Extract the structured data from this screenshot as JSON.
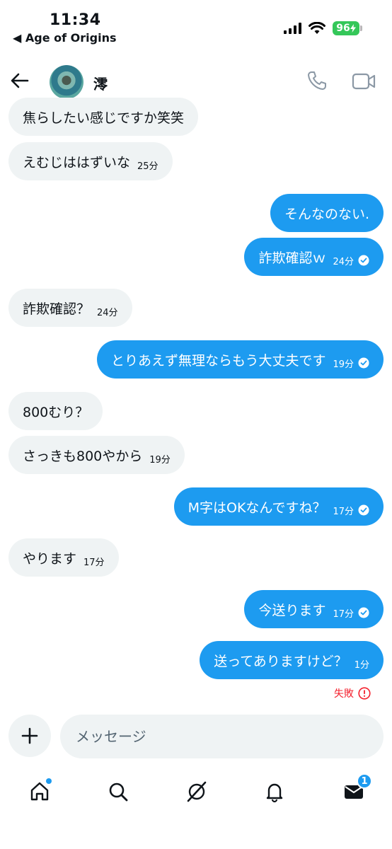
{
  "status": {
    "time": "11:34",
    "back_app": "◀ Age of Origins",
    "battery": "96"
  },
  "header": {
    "name": "澪"
  },
  "messages": [
    {
      "dir": "in",
      "text": "焦らしたい感じですか笑笑",
      "time": ""
    },
    {
      "dir": "in",
      "text": "えむじははずいな",
      "time": "25分"
    },
    {
      "dir": "out",
      "text": "そんなのない.",
      "time": ""
    },
    {
      "dir": "out",
      "text": "詐欺確認ｗ",
      "time": "24分"
    },
    {
      "dir": "in",
      "text": "詐欺確認？",
      "time": "24分"
    },
    {
      "dir": "out",
      "text": "とりあえず無理ならもう大丈夫です",
      "time": "19分"
    },
    {
      "dir": "in",
      "text": "800むり？",
      "time": ""
    },
    {
      "dir": "in",
      "text": "さっきも800やから",
      "time": "19分"
    },
    {
      "dir": "out",
      "text": "M字はOKなんですね？",
      "time": "17分"
    },
    {
      "dir": "in",
      "text": "やります",
      "time": "17分"
    },
    {
      "dir": "out",
      "text": "今送ります",
      "time": "17分"
    },
    {
      "dir": "out",
      "text": "送ってありますけど？",
      "time": "1分"
    }
  ],
  "failed_label": "失敗",
  "compose": {
    "placeholder": "メッセージ"
  },
  "tabs": {
    "messages_badge": "1"
  },
  "colors": {
    "accent": "#1d9bf0",
    "incoming_bg": "#eff3f4",
    "error": "#f4212e",
    "battery": "#34c759"
  }
}
